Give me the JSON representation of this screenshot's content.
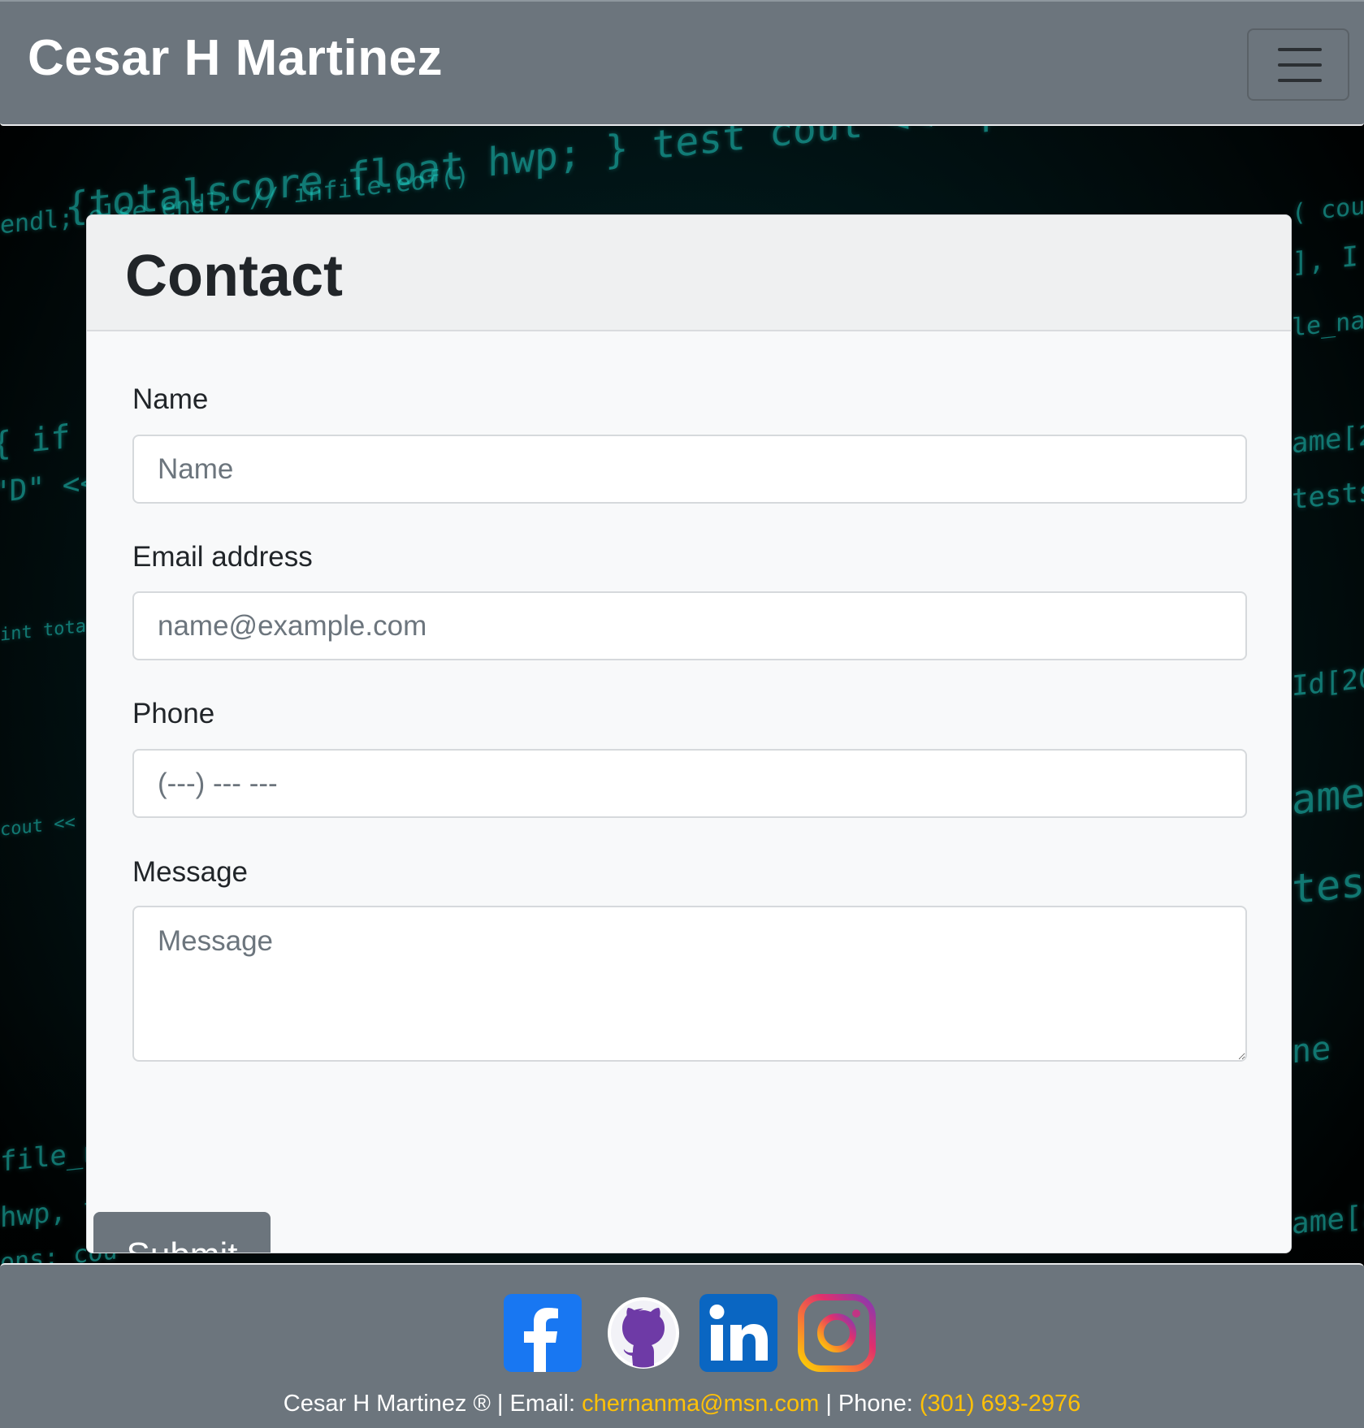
{
  "navbar": {
    "brand": "Cesar H Martinez",
    "toggle_icon": "hamburger-menu-icon"
  },
  "card": {
    "title": "Contact",
    "fields": {
      "name": {
        "label": "Name",
        "placeholder": "Name"
      },
      "email": {
        "label": "Email address",
        "placeholder": "name@example.com"
      },
      "phone": {
        "label": "Phone",
        "placeholder": "(---) --- ---"
      },
      "message": {
        "label": "Message",
        "placeholder": "Message"
      }
    },
    "submit_label": "Submit"
  },
  "footer": {
    "social_icons": [
      "facebook-icon",
      "github-icon",
      "linkedin-icon",
      "instagram-icon"
    ],
    "owner": "Cesar H Martinez ®",
    "separator1": " | Email: ",
    "email": "chernanma@msn.com",
    "separator2": " | Phone: ",
    "phone": "(301) 693-2976"
  },
  "colors": {
    "navbar_bg": "#6c757d",
    "link_accent": "#ffc107",
    "button_bg": "#6c757d",
    "background_code": "#1fd1c6"
  }
}
